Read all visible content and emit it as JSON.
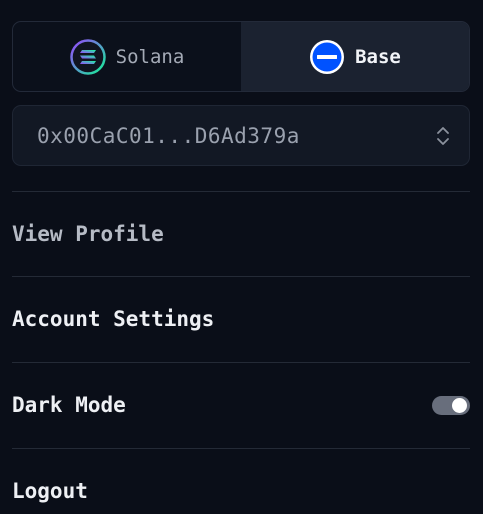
{
  "chain_toggle": {
    "options": [
      {
        "label": "Solana",
        "icon": "solana-logo-icon",
        "selected": false
      },
      {
        "label": "Base",
        "icon": "base-logo-icon",
        "selected": true
      }
    ]
  },
  "wallet": {
    "address": "0x00CaC01...D6Ad379a",
    "selector_icon": "chevron-up-down-icon"
  },
  "menu": {
    "view_profile": "View Profile",
    "account_settings": "Account Settings",
    "dark_mode": "Dark Mode",
    "dark_mode_enabled": true,
    "logout": "Logout"
  },
  "colors": {
    "background": "#0a0e18",
    "selected_tab": "#1b2230",
    "base_blue": "#0052ff",
    "toggle_track": "#686e7c"
  }
}
